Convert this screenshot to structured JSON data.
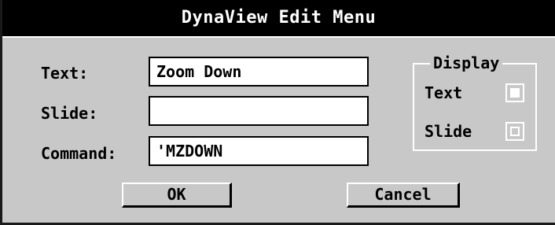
{
  "window": {
    "title": "DynaView Edit Menu"
  },
  "form": {
    "text_label": "Text:",
    "text_value": "Zoom Down",
    "slide_label": "Slide:",
    "slide_value": "",
    "command_label": "Command:",
    "command_value": "'MZDOWN"
  },
  "display": {
    "title": "Display",
    "text_label": "Text",
    "text_checked": true,
    "slide_label": "Slide",
    "slide_checked": false
  },
  "buttons": {
    "ok": "OK",
    "cancel": "Cancel"
  },
  "colors": {
    "dialog_bg": "#c8c8c8",
    "titlebar_bg": "#000000",
    "title_text": "#ffffff"
  }
}
